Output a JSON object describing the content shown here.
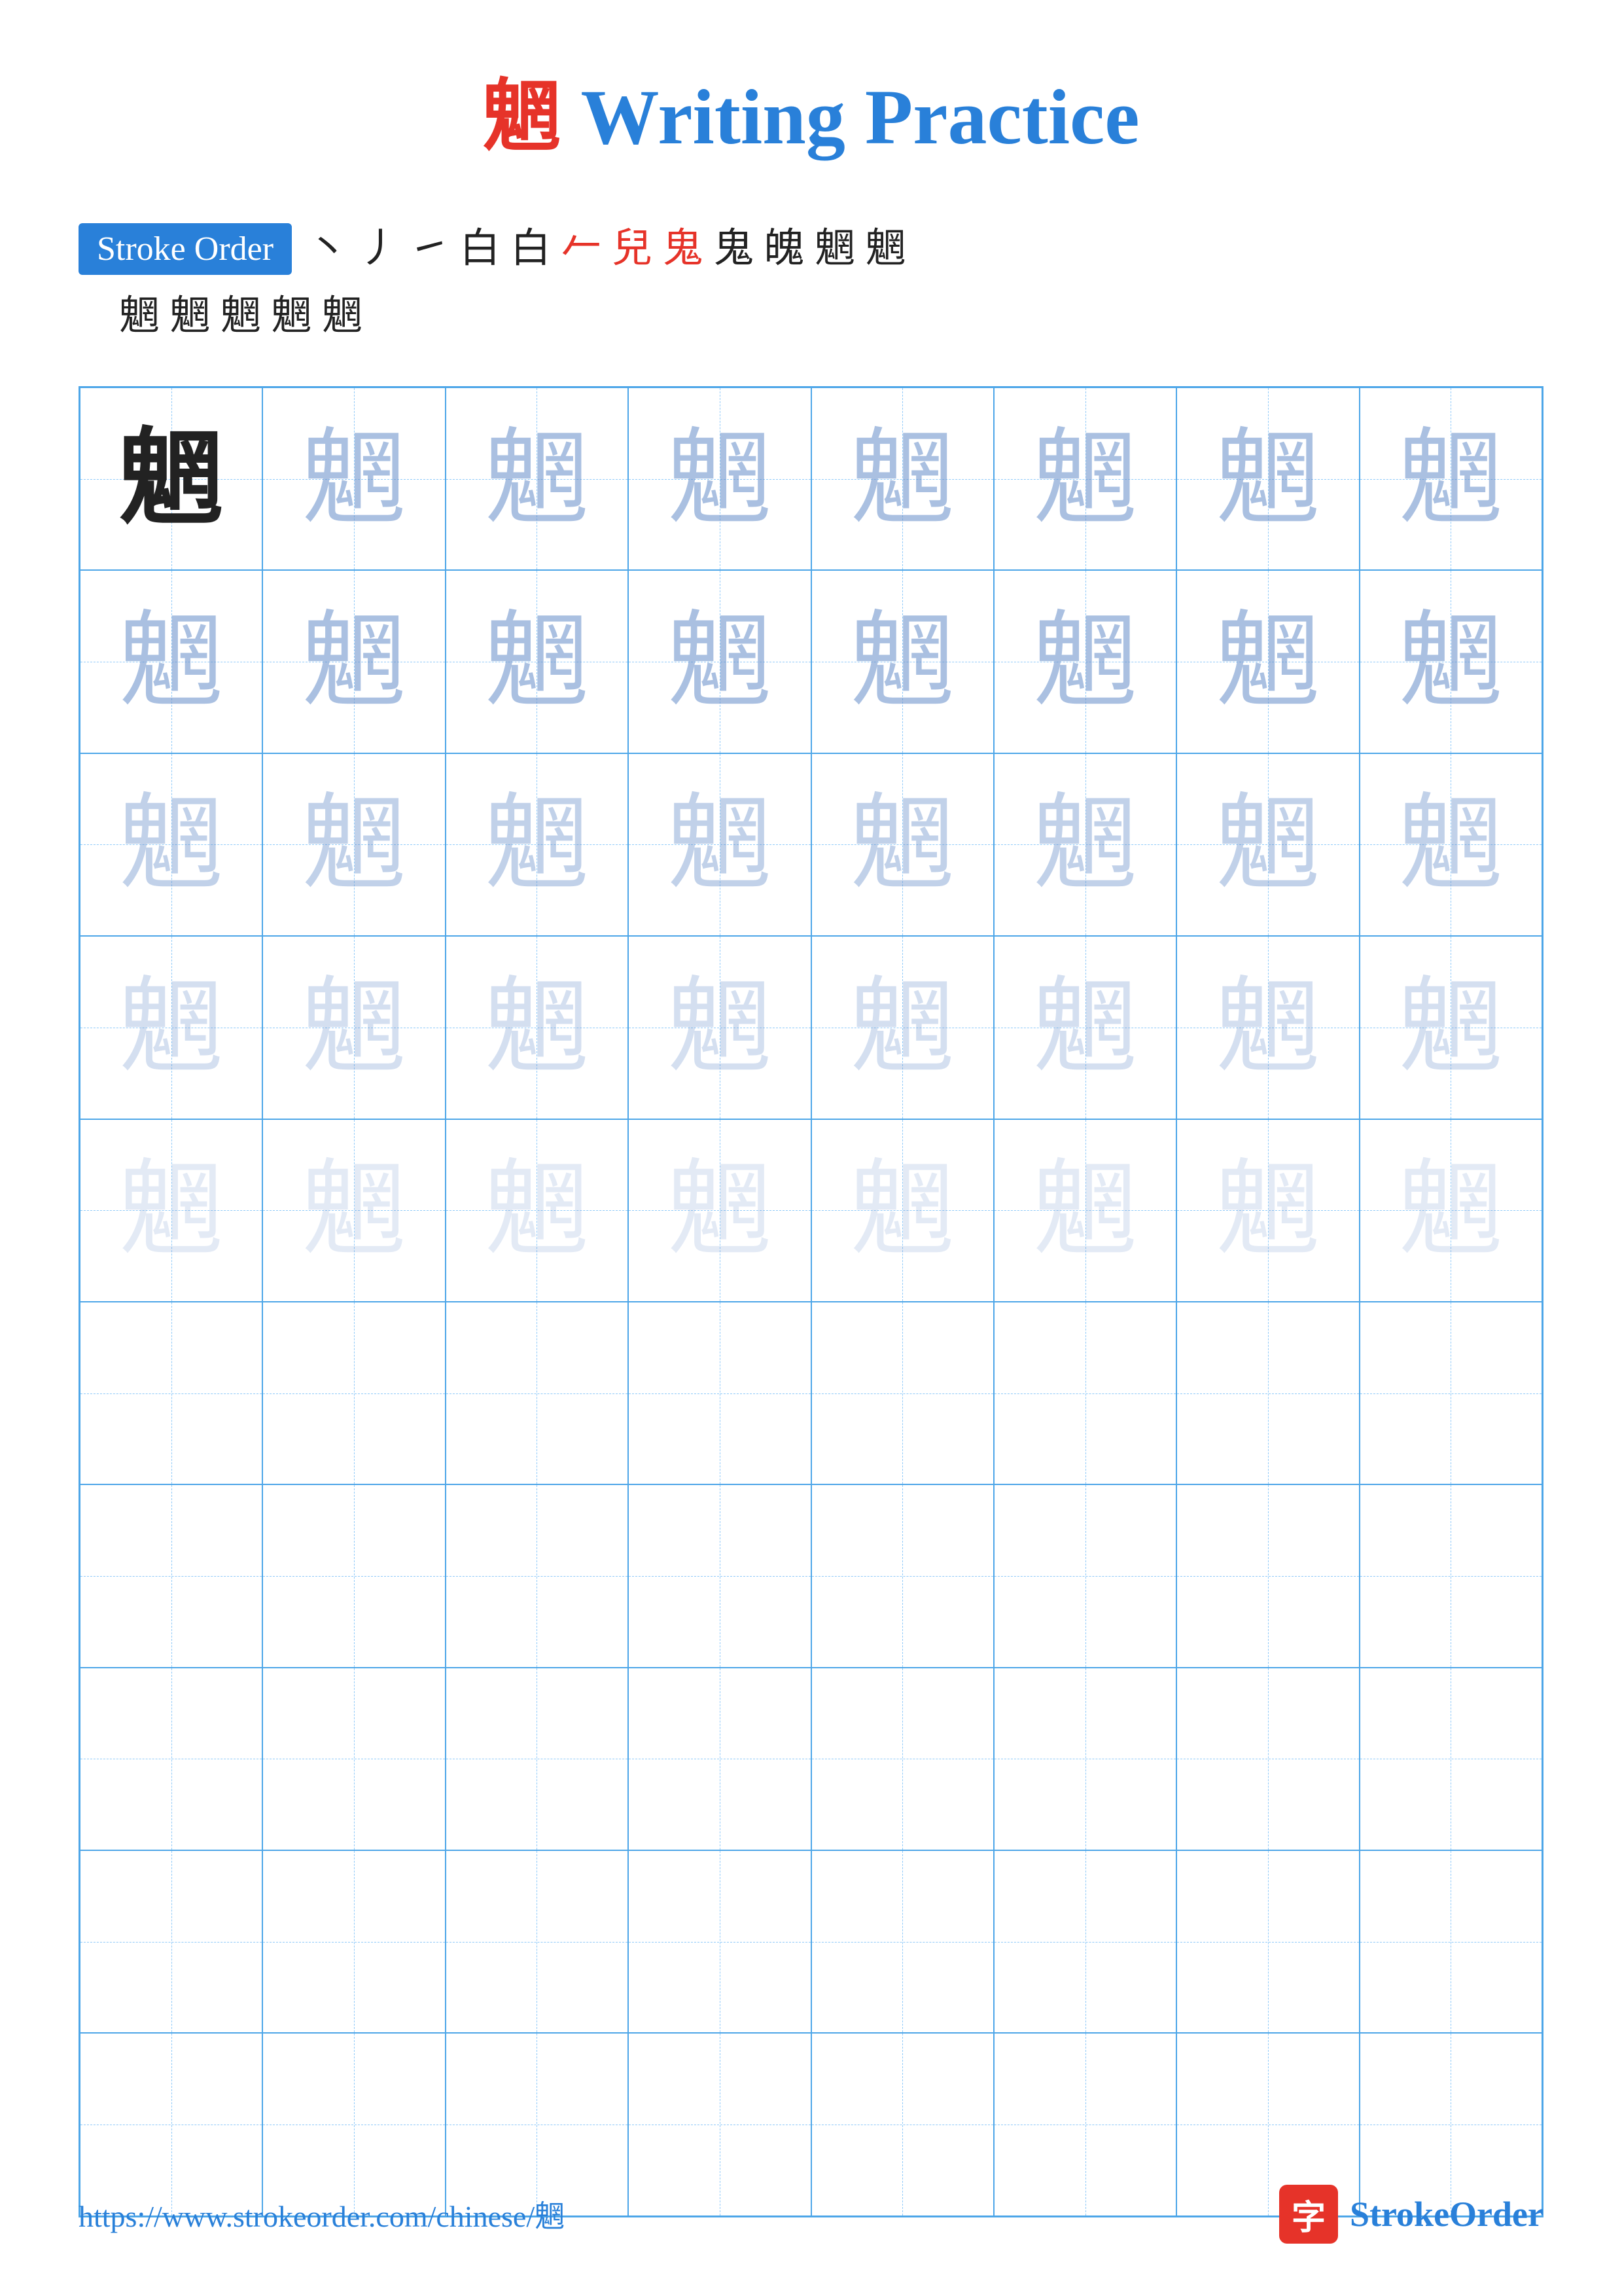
{
  "title": {
    "char": "魍",
    "text": " Writing Practice"
  },
  "stroke_order": {
    "label": "Stroke Order",
    "sequence_line1": "丶 丿 ㇀ 白 白 𠂉 兒 鬼 鬼 魄 魍 魍",
    "sequence_line2": "魍 魍 魍 魍 魍",
    "chars_line1": [
      "丶",
      "丿",
      "㇀",
      "白",
      "白",
      "𠂉",
      "兒",
      "鬼",
      "鬼",
      "魄",
      "魍",
      "魍"
    ],
    "chars_line2": [
      "魍",
      "魍",
      "魍",
      "魍",
      "魍"
    ]
  },
  "grid": {
    "character": "魍",
    "rows": 10,
    "cols": 8
  },
  "footer": {
    "url": "https://www.strokeorder.com/chinese/魍",
    "logo_icon": "字",
    "logo_text": "StrokeOrder"
  }
}
